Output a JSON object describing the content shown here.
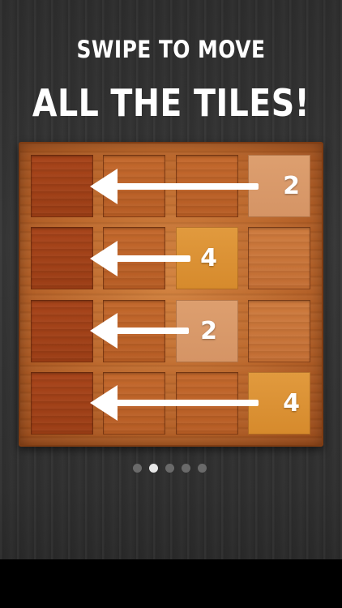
{
  "header": {
    "line1": "SWIPE TO MOVE",
    "line2": "ALL THE TILES!"
  },
  "board": {
    "rows": 4,
    "cols": 4,
    "tiles": [
      {
        "row": 0,
        "col": 3,
        "value": "2"
      },
      {
        "row": 1,
        "col": 2,
        "value": "4"
      },
      {
        "row": 2,
        "col": 2,
        "value": "2"
      },
      {
        "row": 3,
        "col": 3,
        "value": "4"
      }
    ],
    "swipe_direction": "left"
  },
  "pager": {
    "count": 5,
    "active_index": 1
  },
  "colors": {
    "board_wood": "#b9652a",
    "tile_2": "#d9996a",
    "tile_4": "#dc9335",
    "arrow": "#ffffff"
  }
}
